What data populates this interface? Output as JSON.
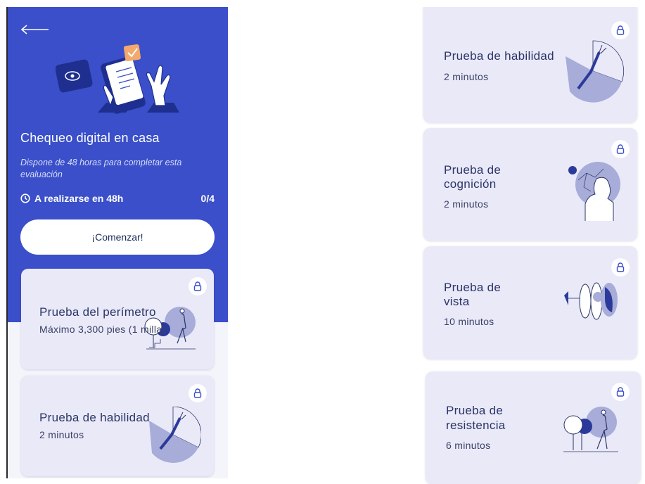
{
  "left_screen": {
    "title": "Chequeo digital en casa",
    "subtitle": "Dispone de 48 horas para completar esta evaluación",
    "deadline_label": "A realizarse en 48h",
    "progress": "0/4",
    "start_button_label": "¡Comenzar!",
    "cards": [
      {
        "title": "Prueba del perímetro",
        "subtitle": "Máximo 3,300 pies (1 milla)"
      },
      {
        "title": "Prueba de habilidad",
        "subtitle": "2 minutos"
      }
    ]
  },
  "right_screen": {
    "cards": [
      {
        "title": "Prueba de habilidad",
        "subtitle": "2 minutos"
      },
      {
        "title_line1": "Prueba de",
        "title_line2": "cognición",
        "subtitle": "2 minutos"
      },
      {
        "title_line1": "Prueba de",
        "title_line2": "vista",
        "subtitle": "10 minutos"
      },
      {
        "title_line1": "Prueba de",
        "title_line2": "resistencia",
        "subtitle": "6 minutos"
      }
    ]
  },
  "colors": {
    "brand_blue": "#3a4fc9",
    "card_bg": "#e9e9f8",
    "text_dark": "#2b3566",
    "accent_orange": "#f2a96b"
  },
  "icons": [
    "back-arrow-icon",
    "clock-icon",
    "lock-icon",
    "eye-icon",
    "checkmark-icon"
  ]
}
